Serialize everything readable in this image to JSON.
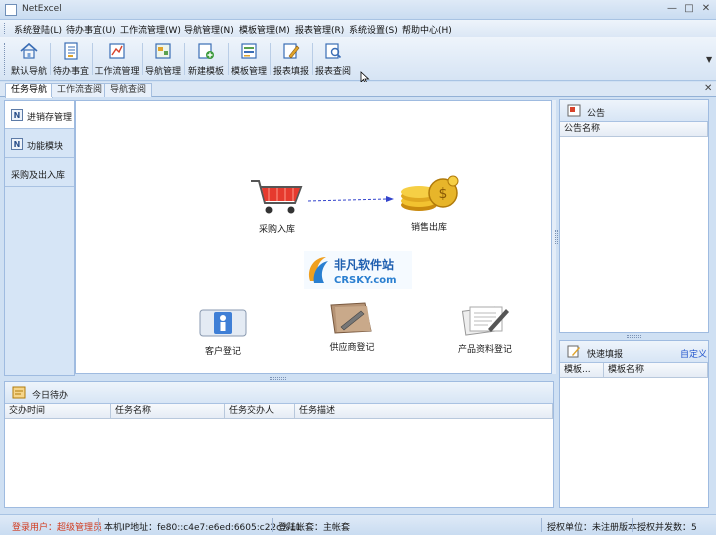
{
  "window": {
    "title": "NetExcel"
  },
  "menu": [
    "系统登陆(L)",
    "待办事宜(U)",
    "工作流管理(W)",
    "导航管理(N)",
    "模板管理(M)",
    "报表管理(R)",
    "系统设置(S)",
    "帮助中心(H)"
  ],
  "toolbar": [
    {
      "label": "默认导航",
      "icon": "home-icon"
    },
    {
      "label": "待办事宜",
      "icon": "todo-list-icon"
    },
    {
      "label": "工作流管理",
      "icon": "workflow-icon"
    },
    {
      "label": "导航管理",
      "icon": "navigation-icon"
    },
    {
      "label": "新建模板",
      "icon": "new-template-icon"
    },
    {
      "label": "模板管理",
      "icon": "template-icon"
    },
    {
      "label": "报表填报",
      "icon": "report-fill-icon"
    },
    {
      "label": "报表查阅",
      "icon": "report-view-icon"
    }
  ],
  "tabs": [
    {
      "label": "任务导航",
      "active": true
    },
    {
      "label": "工作流查阅",
      "active": false
    },
    {
      "label": "导航查阅",
      "active": false
    }
  ],
  "leftnav": [
    {
      "label": "进销存管理",
      "active": true,
      "icon": "N"
    },
    {
      "label": "功能模块",
      "active": false,
      "icon": "N"
    },
    {
      "label": "采购及出入库",
      "active": false,
      "icon": ""
    }
  ],
  "canvas": {
    "nodes": [
      {
        "label": "采购入库",
        "icon": "shopping-cart-icon"
      },
      {
        "label": "销售出库",
        "icon": "gold-coins-icon"
      },
      {
        "label": "客户登记",
        "icon": "customer-card-icon"
      },
      {
        "label": "供应商登记",
        "icon": "supplier-folder-icon"
      },
      {
        "label": "产品资料登记",
        "icon": "product-document-icon"
      }
    ],
    "watermark": {
      "line1": "非凡软件站",
      "line2": "CRSKY.com"
    }
  },
  "todo": {
    "title": "今日待办",
    "columns": [
      "交办时间",
      "任务名称",
      "任务交办人",
      "任务描述"
    ]
  },
  "notice": {
    "title": "公告",
    "columns": [
      "公告名称"
    ]
  },
  "quick": {
    "title": "快速填报",
    "link": "自定义",
    "columns": [
      "模板...",
      "模板名称"
    ]
  },
  "status": {
    "user": "登录用户：超级管理员",
    "ip": "本机IP地址：fe80::c4e7:e6ed:6605:c22c%11",
    "account": "登陆帐套：主帐套",
    "license": "授权单位：未注册版本",
    "concurrency": "授权并发数：5"
  },
  "colors": {
    "accent": "#2255cc",
    "status_user": "#d23a1e",
    "panel_border": "#9fbbe0"
  }
}
